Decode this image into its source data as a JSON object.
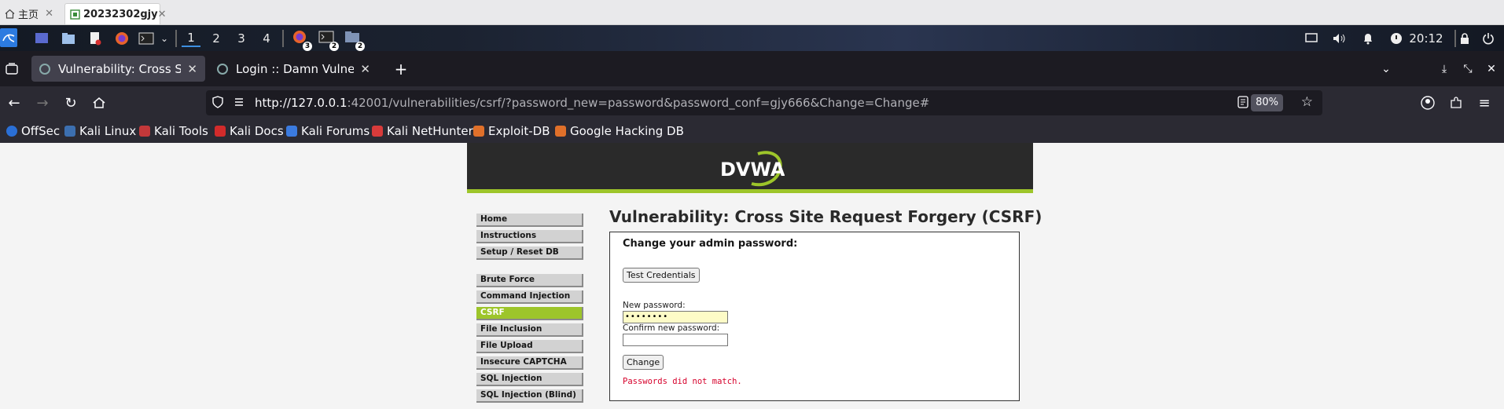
{
  "host_tabs": [
    {
      "label": "主页"
    },
    {
      "label": "20232302gjy"
    }
  ],
  "panel": {
    "workspaces": [
      "1",
      "2",
      "3",
      "4"
    ],
    "active_workspace": "1",
    "firefox_badge": "3",
    "terminal_badge": "2",
    "files_badge": "2",
    "clock": "20:12"
  },
  "firefox": {
    "tabs": [
      {
        "title": "Vulnerability: Cross Site R",
        "active": true
      },
      {
        "title": "Login :: Damn Vulnerable",
        "active": false
      }
    ],
    "url_host": "http://127.0.0.1",
    "url_rest": ":42001/vulnerabilities/csrf/?password_new=password&password_conf=gjy666&Change=Change#",
    "zoom": "80%"
  },
  "bookmarks": [
    {
      "label": "OffSec",
      "icon": "offsec-icon",
      "color": "#2a6fd6"
    },
    {
      "label": "Kali Linux",
      "icon": "kali-icon",
      "color": "#3c6fb0"
    },
    {
      "label": "Kali Tools",
      "icon": "kali-tools-icon",
      "color": "#c3383a"
    },
    {
      "label": "Kali Docs",
      "icon": "kali-docs-icon",
      "color": "#d22b2b"
    },
    {
      "label": "Kali Forums",
      "icon": "kali-forums-icon",
      "color": "#3b7be0"
    },
    {
      "label": "Kali NetHunter",
      "icon": "nethunter-icon",
      "color": "#d83b3b"
    },
    {
      "label": "Exploit-DB",
      "icon": "exploitdb-icon",
      "color": "#e0702a"
    },
    {
      "label": "Google Hacking DB",
      "icon": "ghdb-icon",
      "color": "#e0702a"
    }
  ],
  "dvwa": {
    "logo": "DVWA",
    "menu": [
      {
        "label": "Home",
        "selected": false
      },
      {
        "label": "Instructions",
        "selected": false
      },
      {
        "label": "Setup / Reset DB",
        "selected": false
      },
      {
        "label": "Brute Force",
        "selected": false
      },
      {
        "label": "Command Injection",
        "selected": false
      },
      {
        "label": "CSRF",
        "selected": true
      },
      {
        "label": "File Inclusion",
        "selected": false
      },
      {
        "label": "File Upload",
        "selected": false
      },
      {
        "label": "Insecure CAPTCHA",
        "selected": false
      },
      {
        "label": "SQL Injection",
        "selected": false
      },
      {
        "label": "SQL Injection (Blind)",
        "selected": false
      }
    ],
    "title": "Vulnerability: Cross Site Request Forgery (CSRF)",
    "form": {
      "heading": "Change your admin password:",
      "test_button": "Test Credentials",
      "new_password_label": "New password:",
      "new_password_value": "••••••••",
      "confirm_label": "Confirm new password:",
      "confirm_value": "",
      "change_button": "Change",
      "error": "Passwords did not match."
    },
    "accent": "#9dc52a",
    "error_color": "#d6002b"
  }
}
